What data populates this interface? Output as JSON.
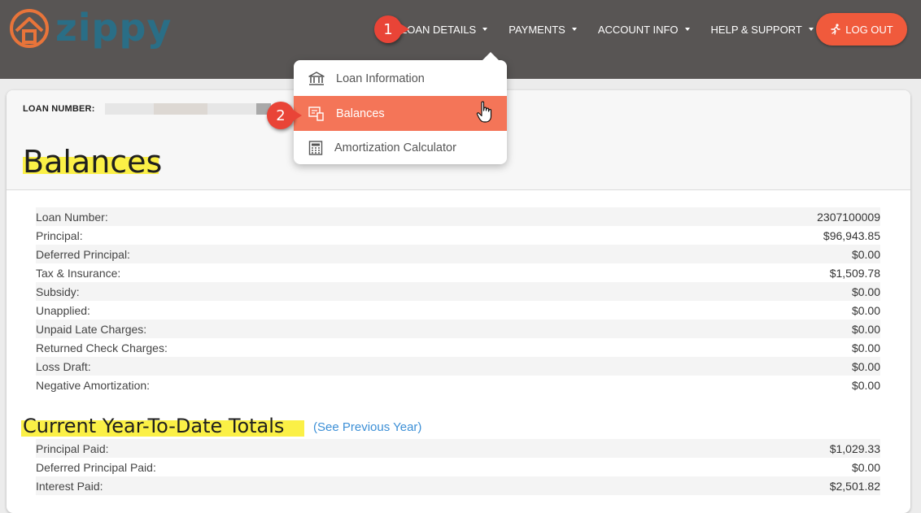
{
  "brand": {
    "logo_text": "zippy",
    "logo_color": "#2a6e86",
    "accent": "#f05a3c"
  },
  "nav": {
    "items": [
      {
        "label": "LOAN DETAILS"
      },
      {
        "label": "PAYMENTS"
      },
      {
        "label": "ACCOUNT INFO"
      },
      {
        "label": "HELP & SUPPORT"
      }
    ],
    "logout_label": "LOG OUT"
  },
  "dropdown": {
    "items": [
      {
        "label": "Loan Information",
        "icon": "bank-icon"
      },
      {
        "label": "Balances",
        "icon": "balances-icon",
        "active": true
      },
      {
        "label": "Amortization Calculator",
        "icon": "calculator-icon"
      }
    ]
  },
  "annotations": {
    "step1": "1",
    "step2": "2"
  },
  "header": {
    "loan_number_label": "LOAN NUMBER:",
    "title": "Balances"
  },
  "balances": [
    {
      "label": "Loan Number:",
      "value": "2307100009"
    },
    {
      "label": "Principal:",
      "value": "$96,943.85"
    },
    {
      "label": "Deferred Principal:",
      "value": "$0.00"
    },
    {
      "label": "Tax & Insurance:",
      "value": "$1,509.78"
    },
    {
      "label": "Subsidy:",
      "value": "$0.00"
    },
    {
      "label": "Unapplied:",
      "value": "$0.00"
    },
    {
      "label": "Unpaid Late Charges:",
      "value": "$0.00"
    },
    {
      "label": "Returned Check Charges:",
      "value": "$0.00"
    },
    {
      "label": "Loss Draft:",
      "value": "$0.00"
    },
    {
      "label": "Negative Amortization:",
      "value": "$0.00"
    }
  ],
  "ytd": {
    "title": "Current Year-To-Date Totals",
    "previous_link": "(See Previous Year)",
    "rows": [
      {
        "label": "Principal Paid:",
        "value": "$1,029.33"
      },
      {
        "label": "Deferred Principal Paid:",
        "value": "$0.00"
      },
      {
        "label": "Interest Paid:",
        "value": "$2,501.82"
      }
    ]
  }
}
